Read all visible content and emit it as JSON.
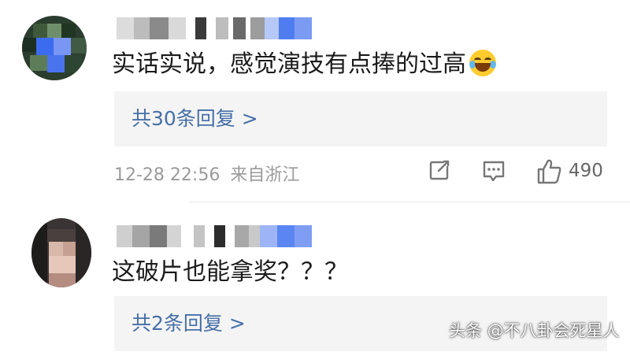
{
  "comments": [
    {
      "text": "实话实说，感觉演技有点捧的过高",
      "emoji": "laughing-tears-icon",
      "replies_label": "共30条回复 >",
      "time": "12-28 22:56",
      "location": "来自浙江",
      "likes": "490"
    },
    {
      "text": "这破片也能拿奖？？？",
      "replies_label": "共2条回复 >"
    }
  ],
  "icons": [
    "share-icon",
    "comment-icon",
    "thumbs-up-icon"
  ],
  "watermark": "头条 @不八卦会死星人",
  "colors": {
    "reply_link": "#456fa8",
    "reply_bg": "#f4f4f4",
    "meta_text": "#9a9a9a",
    "nick_blur": "#4f7df0"
  }
}
